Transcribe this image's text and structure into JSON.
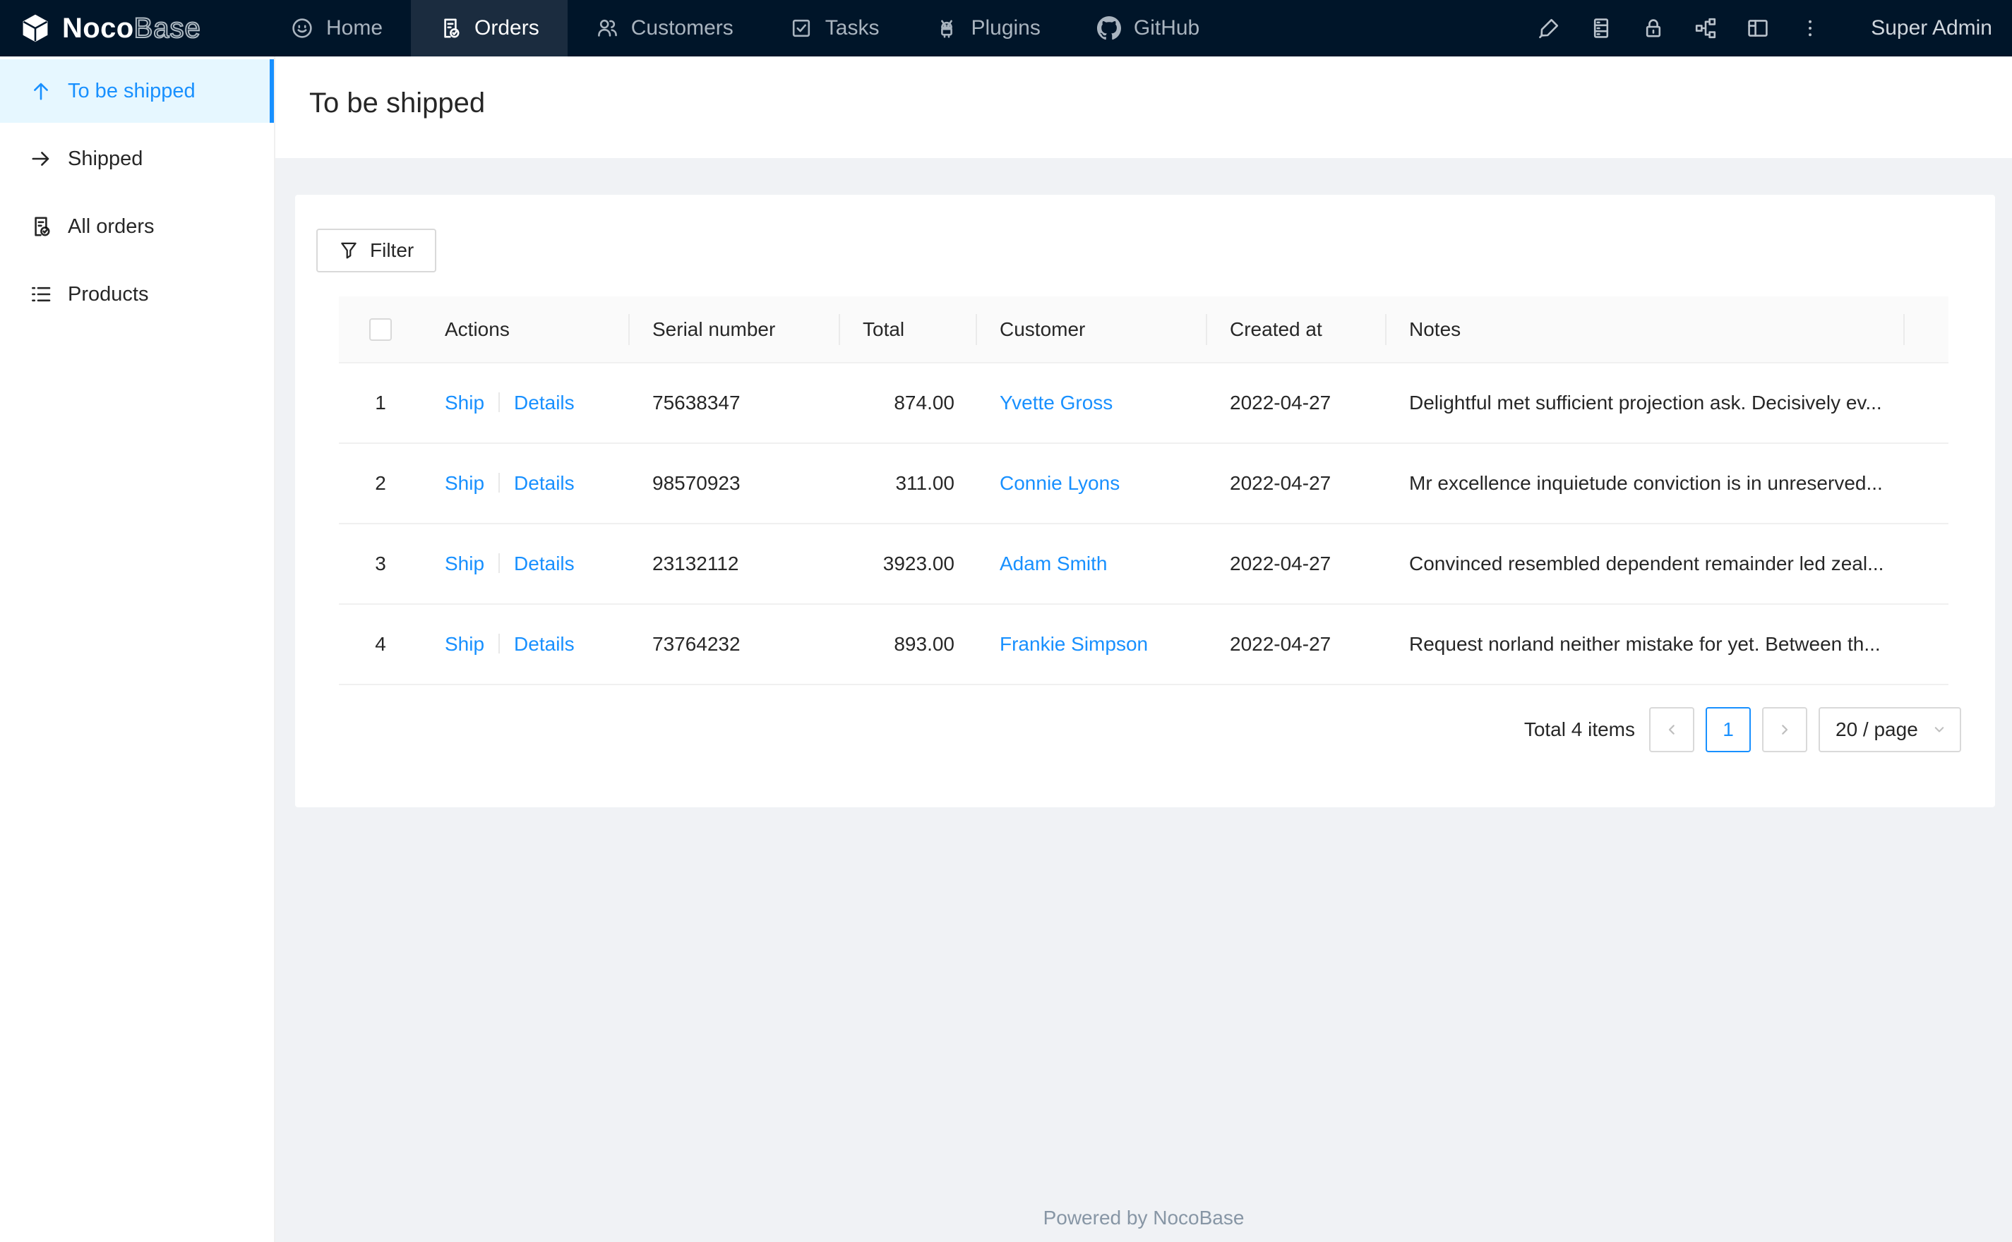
{
  "nav": {
    "brand": {
      "bold": "Noco",
      "light": "Base"
    },
    "items": [
      {
        "label": "Home",
        "icon": "home-icon",
        "active": false
      },
      {
        "label": "Orders",
        "icon": "orders-icon",
        "active": true
      },
      {
        "label": "Customers",
        "icon": "customers-icon",
        "active": false
      },
      {
        "label": "Tasks",
        "icon": "tasks-icon",
        "active": false
      },
      {
        "label": "Plugins",
        "icon": "plugins-icon",
        "active": false
      },
      {
        "label": "GitHub",
        "icon": "github-icon",
        "active": false
      }
    ],
    "right_icons": [
      "highlighter-icon",
      "database-icon",
      "lock-icon",
      "org-chart-icon",
      "layout-icon",
      "more-icon"
    ],
    "user_label": "Super Admin"
  },
  "sidebar": {
    "items": [
      {
        "label": "To be shipped",
        "icon": "arrow-up-icon",
        "active": true
      },
      {
        "label": "Shipped",
        "icon": "arrow-right-icon",
        "active": false
      },
      {
        "label": "All orders",
        "icon": "file-done-icon",
        "active": false
      },
      {
        "label": "Products",
        "icon": "list-icon",
        "active": false
      }
    ]
  },
  "page": {
    "title": "To be shipped"
  },
  "toolbar": {
    "filter_label": "Filter"
  },
  "table": {
    "columns": [
      "Actions",
      "Serial number",
      "Total",
      "Customer",
      "Created at",
      "Notes"
    ],
    "action_labels": [
      "Ship",
      "Details"
    ],
    "rows": [
      {
        "index": "1",
        "serial": "75638347",
        "total": "874.00",
        "customer": "Yvette Gross",
        "created_at": "2022-04-27",
        "notes": "Delightful met sufficient projection ask. Decisively ev..."
      },
      {
        "index": "2",
        "serial": "98570923",
        "total": "311.00",
        "customer": "Connie Lyons",
        "created_at": "2022-04-27",
        "notes": "Mr excellence inquietude conviction is in unreserved..."
      },
      {
        "index": "3",
        "serial": "23132112",
        "total": "3923.00",
        "customer": "Adam Smith",
        "created_at": "2022-04-27",
        "notes": "Convinced resembled dependent remainder led zeal..."
      },
      {
        "index": "4",
        "serial": "73764232",
        "total": "893.00",
        "customer": "Frankie Simpson",
        "created_at": "2022-04-27",
        "notes": "Request norland neither mistake for yet. Between th..."
      }
    ]
  },
  "pagination": {
    "total_label": "Total 4 items",
    "current_page": "1",
    "page_size_label": "20 / page"
  },
  "footer": {
    "text": "Powered by NocoBase"
  },
  "colors": {
    "accent": "#1890ff",
    "nav_bg": "#001529",
    "nav_active_bg": "#1b2c3f",
    "sidebar_active_bg": "#e6f7ff",
    "content_bg": "#f0f2f5",
    "table_header_bg": "#fafafa"
  }
}
